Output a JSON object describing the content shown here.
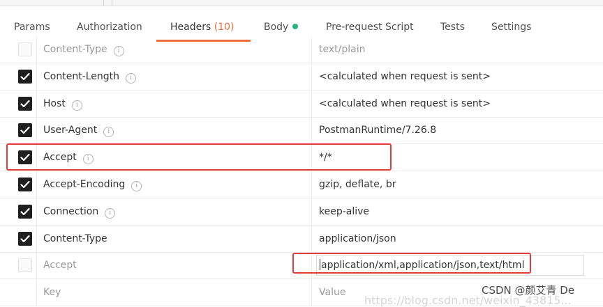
{
  "tabs": [
    {
      "label": "Params"
    },
    {
      "label": "Authorization"
    },
    {
      "label": "Headers",
      "count": "(10)"
    },
    {
      "label": "Body"
    },
    {
      "label": "Pre-request Script"
    },
    {
      "label": "Tests"
    },
    {
      "label": "Settings"
    }
  ],
  "accent_color": "#f26b3a",
  "body_dot_color": "#26b47f",
  "highlight_color": "#e53a3a",
  "rows": [
    {
      "key": "Content-Type",
      "value": "text/plain",
      "checked": false,
      "info": true
    },
    {
      "key": "Content-Length",
      "value": "<calculated when request is sent>",
      "checked": true,
      "info": true
    },
    {
      "key": "Host",
      "value": "<calculated when request is sent>",
      "checked": true,
      "info": true
    },
    {
      "key": "User-Agent",
      "value": "PostmanRuntime/7.26.8",
      "checked": true,
      "info": true
    },
    {
      "key": "Accept",
      "value": "*/*",
      "checked": true,
      "info": true
    },
    {
      "key": "Accept-Encoding",
      "value": "gzip, deflate, br",
      "checked": true,
      "info": true
    },
    {
      "key": "Connection",
      "value": "keep-alive",
      "checked": true,
      "info": true
    },
    {
      "key": "Content-Type",
      "value": "application/json",
      "checked": true,
      "info": false
    },
    {
      "key": "Accept",
      "value": "application/xml,application/json,text/html",
      "checked": false,
      "info": false
    },
    {
      "key": "Key",
      "value": "Value",
      "checked": false,
      "info": false
    }
  ],
  "info_glyph": "i",
  "watermark": "CSDN @颜艾青 De",
  "watermark_url": "https://blog.csdn.net/weixin_43815..."
}
